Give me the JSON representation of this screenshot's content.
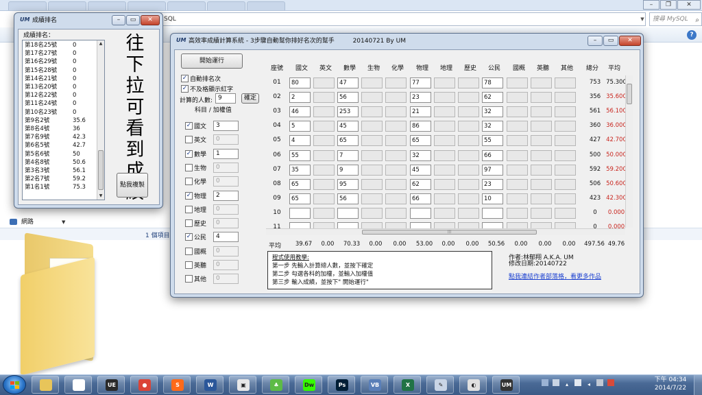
{
  "background": {
    "address": "SQL",
    "search_placeholder": "搜尋 MySQL",
    "nav_network": "網路",
    "item_count": "1 個項目"
  },
  "rank_window": {
    "title": "成績排名",
    "logo": "UM",
    "list_header": "成績排名：",
    "rows": [
      {
        "name": "第18名25號",
        "score": "0"
      },
      {
        "name": "第17名27號",
        "score": "0"
      },
      {
        "name": "第16名29號",
        "score": "0"
      },
      {
        "name": "第15名28號",
        "score": "0"
      },
      {
        "name": "第14名21號",
        "score": "0"
      },
      {
        "name": "第13名20號",
        "score": "0"
      },
      {
        "name": "第12名22號",
        "score": "0"
      },
      {
        "name": "第11名24號",
        "score": "0"
      },
      {
        "name": "第10名23號",
        "score": "0"
      },
      {
        "name": "第9名2號",
        "score": "35.6"
      },
      {
        "name": "第8名4號",
        "score": "36"
      },
      {
        "name": "第7名9號",
        "score": "42.3"
      },
      {
        "name": "第6名5號",
        "score": "42.7"
      },
      {
        "name": "第5名6號",
        "score": "50"
      },
      {
        "name": "第4名8號",
        "score": "50.6"
      },
      {
        "name": "第3名3號",
        "score": "56.1"
      },
      {
        "name": "第2名7號",
        "score": "59.2"
      },
      {
        "name": "第1名1號",
        "score": "75.3"
      }
    ],
    "hint_text": "往下拉可看到成績",
    "copy_button": "點我複製"
  },
  "main_window": {
    "title": "高效率成績計算系統 - 3步驟自動幫你排好名次的幫手",
    "version": "20140721 By UM",
    "logo": "UM",
    "start_button": "開始運行",
    "auto_rank_label": "自動排名次",
    "red_fail_label": "不及格顯示紅字",
    "count_label": "計算的人數:",
    "count_value": "9",
    "confirm_button": "確定",
    "subject_weight_header": "科目 / 加權值",
    "subjects": [
      {
        "name": "國文",
        "checked": true,
        "weight": "3"
      },
      {
        "name": "英文",
        "checked": false,
        "weight": "0"
      },
      {
        "name": "數學",
        "checked": true,
        "weight": "1"
      },
      {
        "name": "生物",
        "checked": false,
        "weight": "0"
      },
      {
        "name": "化學",
        "checked": false,
        "weight": "0"
      },
      {
        "name": "物理",
        "checked": true,
        "weight": "2"
      },
      {
        "name": "地理",
        "checked": false,
        "weight": "0"
      },
      {
        "name": "歷史",
        "checked": false,
        "weight": "0"
      },
      {
        "name": "公民",
        "checked": true,
        "weight": "4"
      },
      {
        "name": "國概",
        "checked": false,
        "weight": "0"
      },
      {
        "name": "英聽",
        "checked": false,
        "weight": "0"
      },
      {
        "name": "其他",
        "checked": false,
        "weight": "0"
      }
    ],
    "grid_headers": [
      "座號",
      "國文",
      "英文",
      "數學",
      "生物",
      "化學",
      "物理",
      "地理",
      "歷史",
      "公民",
      "國概",
      "英聽",
      "其他",
      "總分",
      "平均"
    ],
    "rows": [
      {
        "seat": "01",
        "scores": [
          "80",
          "",
          "47",
          "",
          "",
          "77",
          "",
          "",
          "78",
          "",
          "",
          ""
        ],
        "total": "753",
        "avg": "75.300",
        "fail": false
      },
      {
        "seat": "02",
        "scores": [
          "2",
          "",
          "56",
          "",
          "",
          "23",
          "",
          "",
          "62",
          "",
          "",
          ""
        ],
        "total": "356",
        "avg": "35.600",
        "fail": true
      },
      {
        "seat": "03",
        "scores": [
          "46",
          "",
          "253",
          "",
          "",
          "21",
          "",
          "",
          "32",
          "",
          "",
          ""
        ],
        "total": "561",
        "avg": "56.100",
        "fail": true
      },
      {
        "seat": "04",
        "scores": [
          "5",
          "",
          "45",
          "",
          "",
          "86",
          "",
          "",
          "32",
          "",
          "",
          ""
        ],
        "total": "360",
        "avg": "36.000",
        "fail": true
      },
      {
        "seat": "05",
        "scores": [
          "4",
          "",
          "65",
          "",
          "",
          "65",
          "",
          "",
          "55",
          "",
          "",
          ""
        ],
        "total": "427",
        "avg": "42.700",
        "fail": true
      },
      {
        "seat": "06",
        "scores": [
          "55",
          "",
          "7",
          "",
          "",
          "32",
          "",
          "",
          "66",
          "",
          "",
          ""
        ],
        "total": "500",
        "avg": "50.000",
        "fail": true
      },
      {
        "seat": "07",
        "scores": [
          "35",
          "",
          "9",
          "",
          "",
          "45",
          "",
          "",
          "97",
          "",
          "",
          ""
        ],
        "total": "592",
        "avg": "59.200",
        "fail": true
      },
      {
        "seat": "08",
        "scores": [
          "65",
          "",
          "95",
          "",
          "",
          "62",
          "",
          "",
          "23",
          "",
          "",
          ""
        ],
        "total": "506",
        "avg": "50.600",
        "fail": true
      },
      {
        "seat": "09",
        "scores": [
          "65",
          "",
          "56",
          "",
          "",
          "66",
          "",
          "",
          "10",
          "",
          "",
          ""
        ],
        "total": "423",
        "avg": "42.300",
        "fail": true
      },
      {
        "seat": "10",
        "scores": [
          "",
          "",
          "",
          "",
          "",
          "",
          "",
          "",
          "",
          "",
          "",
          ""
        ],
        "total": "0",
        "avg": "0.000",
        "fail": true
      },
      {
        "seat": "11",
        "scores": [
          "",
          "",
          "",
          "",
          "",
          "",
          "",
          "",
          "",
          "",
          "",
          ""
        ],
        "total": "0",
        "avg": "0.000",
        "fail": true
      }
    ],
    "avg_label": "平均",
    "averages": [
      "39.67",
      "0.00",
      "70.33",
      "0.00",
      "0.00",
      "53.00",
      "0.00",
      "0.00",
      "50.56",
      "0.00",
      "0.00",
      "0.00",
      "497.56",
      "49.76"
    ],
    "instructions": {
      "title": "程式使用教學:",
      "step1": "第一步 先輸入計算總人數，並按下確定",
      "step2": "第二步 勾選各科的加權，並輸入加權值",
      "step3": "第三步 輸入成績，並按下\" 開始運行\""
    },
    "author": "作者:林郁翔 A.K.A. UM",
    "modified": "修改日期:20140722",
    "link": "點我連結作者部落格，看更多作品",
    "colors": {
      "fail_red": "#c8231c",
      "link_blue": "#1a3fd0"
    }
  },
  "taskbar": {
    "apps": [
      "explorer",
      "window",
      "ue-editor",
      "chrome",
      "sublime",
      "word",
      "app",
      "game",
      "dreamweaver",
      "photoshop",
      "vb",
      "excel",
      "paint",
      "app2",
      "um"
    ],
    "clock_time": "下午 04:34",
    "clock_date": "2014/7/22"
  }
}
